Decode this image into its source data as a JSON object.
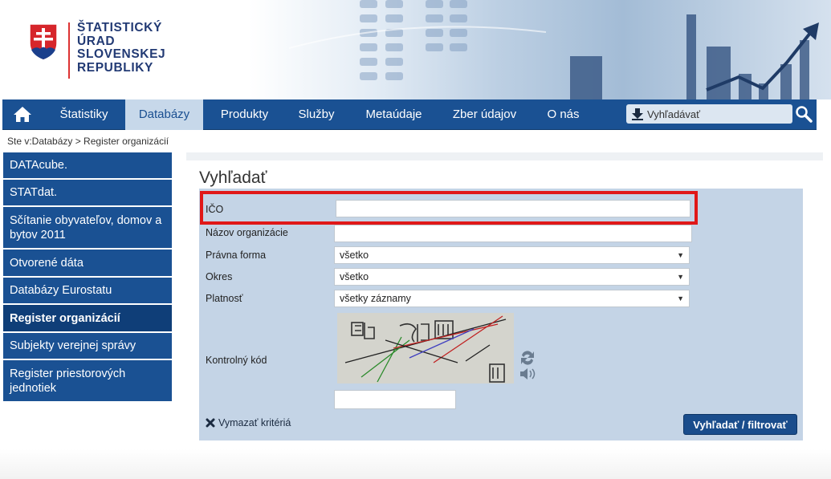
{
  "header": {
    "logo_lines": [
      "ŠTATISTICKÝ",
      "ÚRAD",
      "SLOVENSKEJ",
      "REPUBLIKY"
    ]
  },
  "nav": {
    "items": [
      {
        "label": "Štatistiky",
        "active": false
      },
      {
        "label": "Databázy",
        "active": true
      },
      {
        "label": "Produkty",
        "active": false
      },
      {
        "label": "Služby",
        "active": false
      },
      {
        "label": "Metaúdaje",
        "active": false
      },
      {
        "label": "Zber údajov",
        "active": false
      },
      {
        "label": "O nás",
        "active": false
      }
    ],
    "search_placeholder": "Vyhľadávať"
  },
  "breadcrumb": "Ste v:Databázy > Register organizácií",
  "sidebar": {
    "items": [
      {
        "label": "DATAcube."
      },
      {
        "label": "STATdat."
      },
      {
        "label": "Sčítanie obyvateľov, domov a bytov 2011"
      },
      {
        "label": "Otvorené dáta"
      },
      {
        "label": "Databázy Eurostatu"
      },
      {
        "label": "Register organizácií"
      },
      {
        "label": "Subjekty verejnej správy"
      },
      {
        "label": "Register priestorových jednotiek"
      }
    ]
  },
  "main": {
    "heading": "Vyhľadať",
    "form": {
      "ico_label": "IČO",
      "ico_value": "",
      "nazov_label": "Názov organizácie",
      "nazov_value": "",
      "pravna_label": "Právna forma",
      "pravna_value": "všetko",
      "okres_label": "Okres",
      "okres_value": "všetko",
      "platnost_label": "Platnosť",
      "platnost_value": "všetky záznamy",
      "kod_label": "Kontrolný kód",
      "kod_value": "",
      "clear_label": "Vymazať kritériá",
      "submit_label": "Vyhľadať / filtrovať"
    }
  },
  "colors": {
    "nav_bg": "#1a5193",
    "nav_active_bg": "#c7d8ea",
    "form_bg": "#c4d4e6",
    "highlight": "#e01818",
    "submit_bg": "#1a4d8c"
  }
}
